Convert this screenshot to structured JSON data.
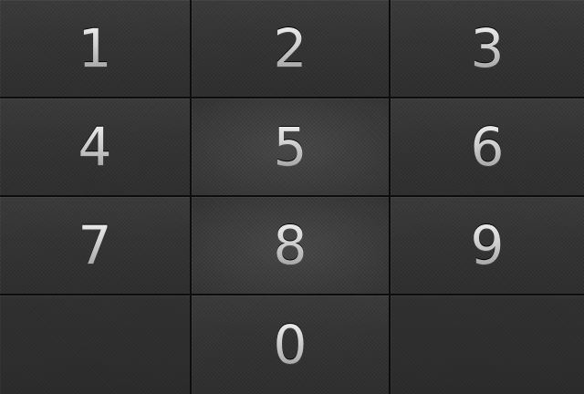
{
  "keypad": {
    "keys": [
      {
        "label": "1"
      },
      {
        "label": "2"
      },
      {
        "label": "3"
      },
      {
        "label": "4"
      },
      {
        "label": "5"
      },
      {
        "label": "6"
      },
      {
        "label": "7"
      },
      {
        "label": "8"
      },
      {
        "label": "9"
      },
      {
        "label": ""
      },
      {
        "label": "0"
      },
      {
        "label": ""
      }
    ]
  },
  "colors": {
    "key_background": "#363636",
    "key_center_background": "#444444",
    "divider": "#0d0d0d",
    "digit": "#d0d0d0"
  }
}
